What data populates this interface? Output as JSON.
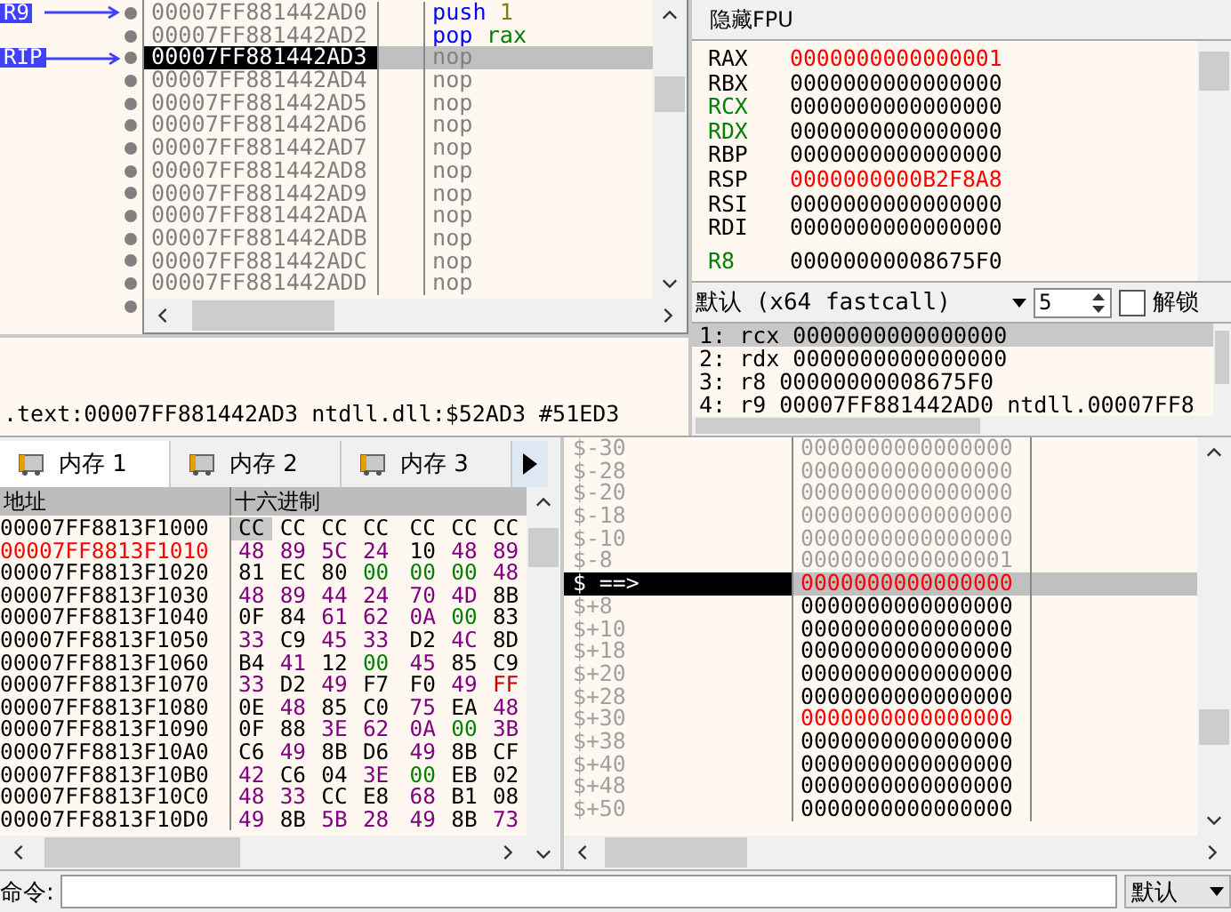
{
  "disassembly": {
    "rows": [
      {
        "label": "R9",
        "address": "00007FF881442AD0",
        "mnemonic": "push",
        "kind": "stack",
        "operands": [
          {
            "text": "1",
            "kind": "imm"
          }
        ],
        "selected": false
      },
      {
        "address": "00007FF881442AD2",
        "mnemonic": "pop",
        "kind": "stack",
        "operands": [
          {
            "text": "rax",
            "kind": "reg"
          }
        ],
        "selected": false
      },
      {
        "label": "RIP",
        "address": "00007FF881442AD3",
        "mnemonic": "nop",
        "kind": "nop",
        "selected": true
      },
      {
        "address": "00007FF881442AD4",
        "mnemonic": "nop",
        "kind": "nop",
        "selected": false
      },
      {
        "address": "00007FF881442AD5",
        "mnemonic": "nop",
        "kind": "nop",
        "selected": false
      },
      {
        "address": "00007FF881442AD6",
        "mnemonic": "nop",
        "kind": "nop",
        "selected": false
      },
      {
        "address": "00007FF881442AD7",
        "mnemonic": "nop",
        "kind": "nop",
        "selected": false
      },
      {
        "address": "00007FF881442AD8",
        "mnemonic": "nop",
        "kind": "nop",
        "selected": false
      },
      {
        "address": "00007FF881442AD9",
        "mnemonic": "nop",
        "kind": "nop",
        "selected": false
      },
      {
        "address": "00007FF881442ADA",
        "mnemonic": "nop",
        "kind": "nop",
        "selected": false
      },
      {
        "address": "00007FF881442ADB",
        "mnemonic": "nop",
        "kind": "nop",
        "selected": false
      },
      {
        "address": "00007FF881442ADC",
        "mnemonic": "nop",
        "kind": "nop",
        "selected": false
      },
      {
        "address": "00007FF881442ADD",
        "mnemonic": "nop",
        "kind": "nop",
        "selected": false
      }
    ]
  },
  "info_line": ".text:00007FF881442AD3 ntdll.dll:$52AD3 #51ED3",
  "registers": {
    "header": "隐藏FPU",
    "groups": [
      [
        {
          "name": "RAX",
          "value": "0000000000000001",
          "changed": true,
          "color": "#000000"
        },
        {
          "name": "RBX",
          "value": "0000000000000000",
          "changed": false,
          "color": "#000000"
        },
        {
          "name": "RCX",
          "value": "0000000000000000",
          "changed": false,
          "color": "#008000"
        },
        {
          "name": "RDX",
          "value": "0000000000000000",
          "changed": false,
          "color": "#008000"
        },
        {
          "name": "RBP",
          "value": "0000000000000000",
          "changed": false,
          "color": "#000000"
        },
        {
          "name": "RSP",
          "value": "0000000000B2F8A8",
          "changed": true,
          "color": "#000000"
        },
        {
          "name": "RSI",
          "value": "0000000000000000",
          "changed": false,
          "color": "#000000"
        },
        {
          "name": "RDI",
          "value": "0000000000000000",
          "changed": false,
          "color": "#000000"
        }
      ],
      [
        {
          "name": "R8",
          "value": "00000000008675F0",
          "changed": false,
          "color": "#008000"
        }
      ]
    ]
  },
  "calling_convention": {
    "value": "默认 (x64 fastcall)",
    "count": "5",
    "lock_label": "解锁",
    "locked": false
  },
  "arguments": [
    {
      "text": "1: rcx 0000000000000000",
      "selected": true
    },
    {
      "text": "2: rdx 0000000000000000",
      "selected": false
    },
    {
      "text": "3: r8 00000000008675F0",
      "selected": false
    },
    {
      "text": "4: r9 00007FF881442AD0 ntdll.00007FF8",
      "selected": false
    }
  ],
  "memory_tabs": [
    {
      "label": "内存 1",
      "selected": true
    },
    {
      "label": "内存 2",
      "selected": false
    },
    {
      "label": "内存 3",
      "selected": false
    }
  ],
  "dump": {
    "columns": [
      "地址",
      "十六进制"
    ],
    "rows": [
      {
        "address": "00007FF8813F1000",
        "modified": false,
        "bytes": [
          {
            "text": "CC",
            "color": "#000000",
            "selected": true
          },
          {
            "text": "CC",
            "color": "#000000"
          },
          {
            "text": "CC",
            "color": "#000000"
          },
          {
            "text": "CC",
            "color": "#000000"
          },
          {
            "text": "CC",
            "color": "#000000"
          },
          {
            "text": "CC",
            "color": "#000000"
          },
          {
            "text": "CC",
            "color": "#000000"
          }
        ]
      },
      {
        "address": "00007FF8813F1010",
        "modified": true,
        "bytes": [
          {
            "text": "48",
            "color": "#800080"
          },
          {
            "text": "89",
            "color": "#800080"
          },
          {
            "text": "5C",
            "color": "#800080"
          },
          {
            "text": "24",
            "color": "#800080"
          },
          {
            "text": "10",
            "color": "#000000"
          },
          {
            "text": "48",
            "color": "#800080"
          },
          {
            "text": "89",
            "color": "#800080"
          }
        ]
      },
      {
        "address": "00007FF8813F1020",
        "modified": false,
        "bytes": [
          {
            "text": "81",
            "color": "#000000"
          },
          {
            "text": "EC",
            "color": "#000000"
          },
          {
            "text": "80",
            "color": "#000000"
          },
          {
            "text": "00",
            "color": "#008000"
          },
          {
            "text": "00",
            "color": "#008000"
          },
          {
            "text": "00",
            "color": "#008000"
          },
          {
            "text": "48",
            "color": "#800080"
          }
        ]
      },
      {
        "address": "00007FF8813F1030",
        "modified": false,
        "bytes": [
          {
            "text": "48",
            "color": "#800080"
          },
          {
            "text": "89",
            "color": "#800080"
          },
          {
            "text": "44",
            "color": "#800080"
          },
          {
            "text": "24",
            "color": "#800080"
          },
          {
            "text": "70",
            "color": "#800080"
          },
          {
            "text": "4D",
            "color": "#800080"
          },
          {
            "text": "8B",
            "color": "#000000"
          }
        ]
      },
      {
        "address": "00007FF8813F1040",
        "modified": false,
        "bytes": [
          {
            "text": "0F",
            "color": "#000000"
          },
          {
            "text": "84",
            "color": "#000000"
          },
          {
            "text": "61",
            "color": "#800080"
          },
          {
            "text": "62",
            "color": "#800080"
          },
          {
            "text": "0A",
            "color": "#800080"
          },
          {
            "text": "00",
            "color": "#008000"
          },
          {
            "text": "83",
            "color": "#000000"
          }
        ]
      },
      {
        "address": "00007FF8813F1050",
        "modified": false,
        "bytes": [
          {
            "text": "33",
            "color": "#800080"
          },
          {
            "text": "C9",
            "color": "#000000"
          },
          {
            "text": "45",
            "color": "#800080"
          },
          {
            "text": "33",
            "color": "#800080"
          },
          {
            "text": "D2",
            "color": "#000000"
          },
          {
            "text": "4C",
            "color": "#800080"
          },
          {
            "text": "8D",
            "color": "#000000"
          }
        ]
      },
      {
        "address": "00007FF8813F1060",
        "modified": false,
        "bytes": [
          {
            "text": "B4",
            "color": "#000000"
          },
          {
            "text": "41",
            "color": "#800080"
          },
          {
            "text": "12",
            "color": "#000000"
          },
          {
            "text": "00",
            "color": "#008000"
          },
          {
            "text": "45",
            "color": "#800080"
          },
          {
            "text": "85",
            "color": "#000000"
          },
          {
            "text": "C9",
            "color": "#000000"
          }
        ]
      },
      {
        "address": "00007FF8813F1070",
        "modified": false,
        "bytes": [
          {
            "text": "33",
            "color": "#800080"
          },
          {
            "text": "D2",
            "color": "#000000"
          },
          {
            "text": "49",
            "color": "#800080"
          },
          {
            "text": "F7",
            "color": "#000000"
          },
          {
            "text": "F0",
            "color": "#000000"
          },
          {
            "text": "49",
            "color": "#800080"
          },
          {
            "text": "FF",
            "color": "#c00000"
          }
        ]
      },
      {
        "address": "00007FF8813F1080",
        "modified": false,
        "bytes": [
          {
            "text": "0E",
            "color": "#000000"
          },
          {
            "text": "48",
            "color": "#800080"
          },
          {
            "text": "85",
            "color": "#000000"
          },
          {
            "text": "C0",
            "color": "#000000"
          },
          {
            "text": "75",
            "color": "#800080"
          },
          {
            "text": "EA",
            "color": "#000000"
          },
          {
            "text": "48",
            "color": "#800080"
          }
        ]
      },
      {
        "address": "00007FF8813F1090",
        "modified": false,
        "bytes": [
          {
            "text": "0F",
            "color": "#000000"
          },
          {
            "text": "88",
            "color": "#000000"
          },
          {
            "text": "3E",
            "color": "#800080"
          },
          {
            "text": "62",
            "color": "#800080"
          },
          {
            "text": "0A",
            "color": "#800080"
          },
          {
            "text": "00",
            "color": "#008000"
          },
          {
            "text": "3B",
            "color": "#800080"
          }
        ]
      },
      {
        "address": "00007FF8813F10A0",
        "modified": false,
        "bytes": [
          {
            "text": "C6",
            "color": "#000000"
          },
          {
            "text": "49",
            "color": "#800080"
          },
          {
            "text": "8B",
            "color": "#000000"
          },
          {
            "text": "D6",
            "color": "#000000"
          },
          {
            "text": "49",
            "color": "#800080"
          },
          {
            "text": "8B",
            "color": "#000000"
          },
          {
            "text": "CF",
            "color": "#000000"
          }
        ]
      },
      {
        "address": "00007FF8813F10B0",
        "modified": false,
        "bytes": [
          {
            "text": "42",
            "color": "#800080"
          },
          {
            "text": "C6",
            "color": "#000000"
          },
          {
            "text": "04",
            "color": "#000000"
          },
          {
            "text": "3E",
            "color": "#800080"
          },
          {
            "text": "00",
            "color": "#008000"
          },
          {
            "text": "EB",
            "color": "#000000"
          },
          {
            "text": "02",
            "color": "#000000"
          }
        ]
      },
      {
        "address": "00007FF8813F10C0",
        "modified": false,
        "bytes": [
          {
            "text": "48",
            "color": "#800080"
          },
          {
            "text": "33",
            "color": "#800080"
          },
          {
            "text": "CC",
            "color": "#000000"
          },
          {
            "text": "E8",
            "color": "#000000"
          },
          {
            "text": "68",
            "color": "#800080"
          },
          {
            "text": "B1",
            "color": "#000000"
          },
          {
            "text": "08",
            "color": "#000000"
          }
        ]
      },
      {
        "address": "00007FF8813F10D0",
        "modified": false,
        "bytes": [
          {
            "text": "49",
            "color": "#800080"
          },
          {
            "text": "8B",
            "color": "#000000"
          },
          {
            "text": "5B",
            "color": "#800080"
          },
          {
            "text": "28",
            "color": "#800080"
          },
          {
            "text": "49",
            "color": "#800080"
          },
          {
            "text": "8B",
            "color": "#000000"
          },
          {
            "text": "73",
            "color": "#800080"
          }
        ]
      }
    ]
  },
  "stack": {
    "rows": [
      {
        "offset": "$-30",
        "value": "0000000000000000",
        "color": "#a0a0a0",
        "selected": false
      },
      {
        "offset": "$-28",
        "value": "0000000000000000",
        "color": "#a0a0a0",
        "selected": false
      },
      {
        "offset": "$-20",
        "value": "0000000000000000",
        "color": "#a0a0a0",
        "selected": false
      },
      {
        "offset": "$-18",
        "value": "0000000000000000",
        "color": "#a0a0a0",
        "selected": false
      },
      {
        "offset": "$-10",
        "value": "0000000000000000",
        "color": "#a0a0a0",
        "selected": false
      },
      {
        "offset": "$-8",
        "value": "0000000000000001",
        "color": "#a0a0a0",
        "selected": false
      },
      {
        "offset": "$ ==>",
        "value": "0000000000000000",
        "color": "#ff0000",
        "selected": true
      },
      {
        "offset": "$+8",
        "value": "0000000000000000",
        "color": "#000000",
        "selected": false
      },
      {
        "offset": "$+10",
        "value": "0000000000000000",
        "color": "#000000",
        "selected": false
      },
      {
        "offset": "$+18",
        "value": "0000000000000000",
        "color": "#000000",
        "selected": false
      },
      {
        "offset": "$+20",
        "value": "0000000000000000",
        "color": "#000000",
        "selected": false
      },
      {
        "offset": "$+28",
        "value": "0000000000000000",
        "color": "#000000",
        "selected": false
      },
      {
        "offset": "$+30",
        "value": "0000000000000000",
        "color": "#ff0000",
        "selected": false
      },
      {
        "offset": "$+38",
        "value": "0000000000000000",
        "color": "#000000",
        "selected": false
      },
      {
        "offset": "$+40",
        "value": "0000000000000000",
        "color": "#000000",
        "selected": false
      },
      {
        "offset": "$+48",
        "value": "0000000000000000",
        "color": "#000000",
        "selected": false
      },
      {
        "offset": "$+50",
        "value": "0000000000000000",
        "color": "#000000",
        "selected": false
      }
    ]
  },
  "command_bar": {
    "label": "命令:",
    "mode": "默认"
  }
}
